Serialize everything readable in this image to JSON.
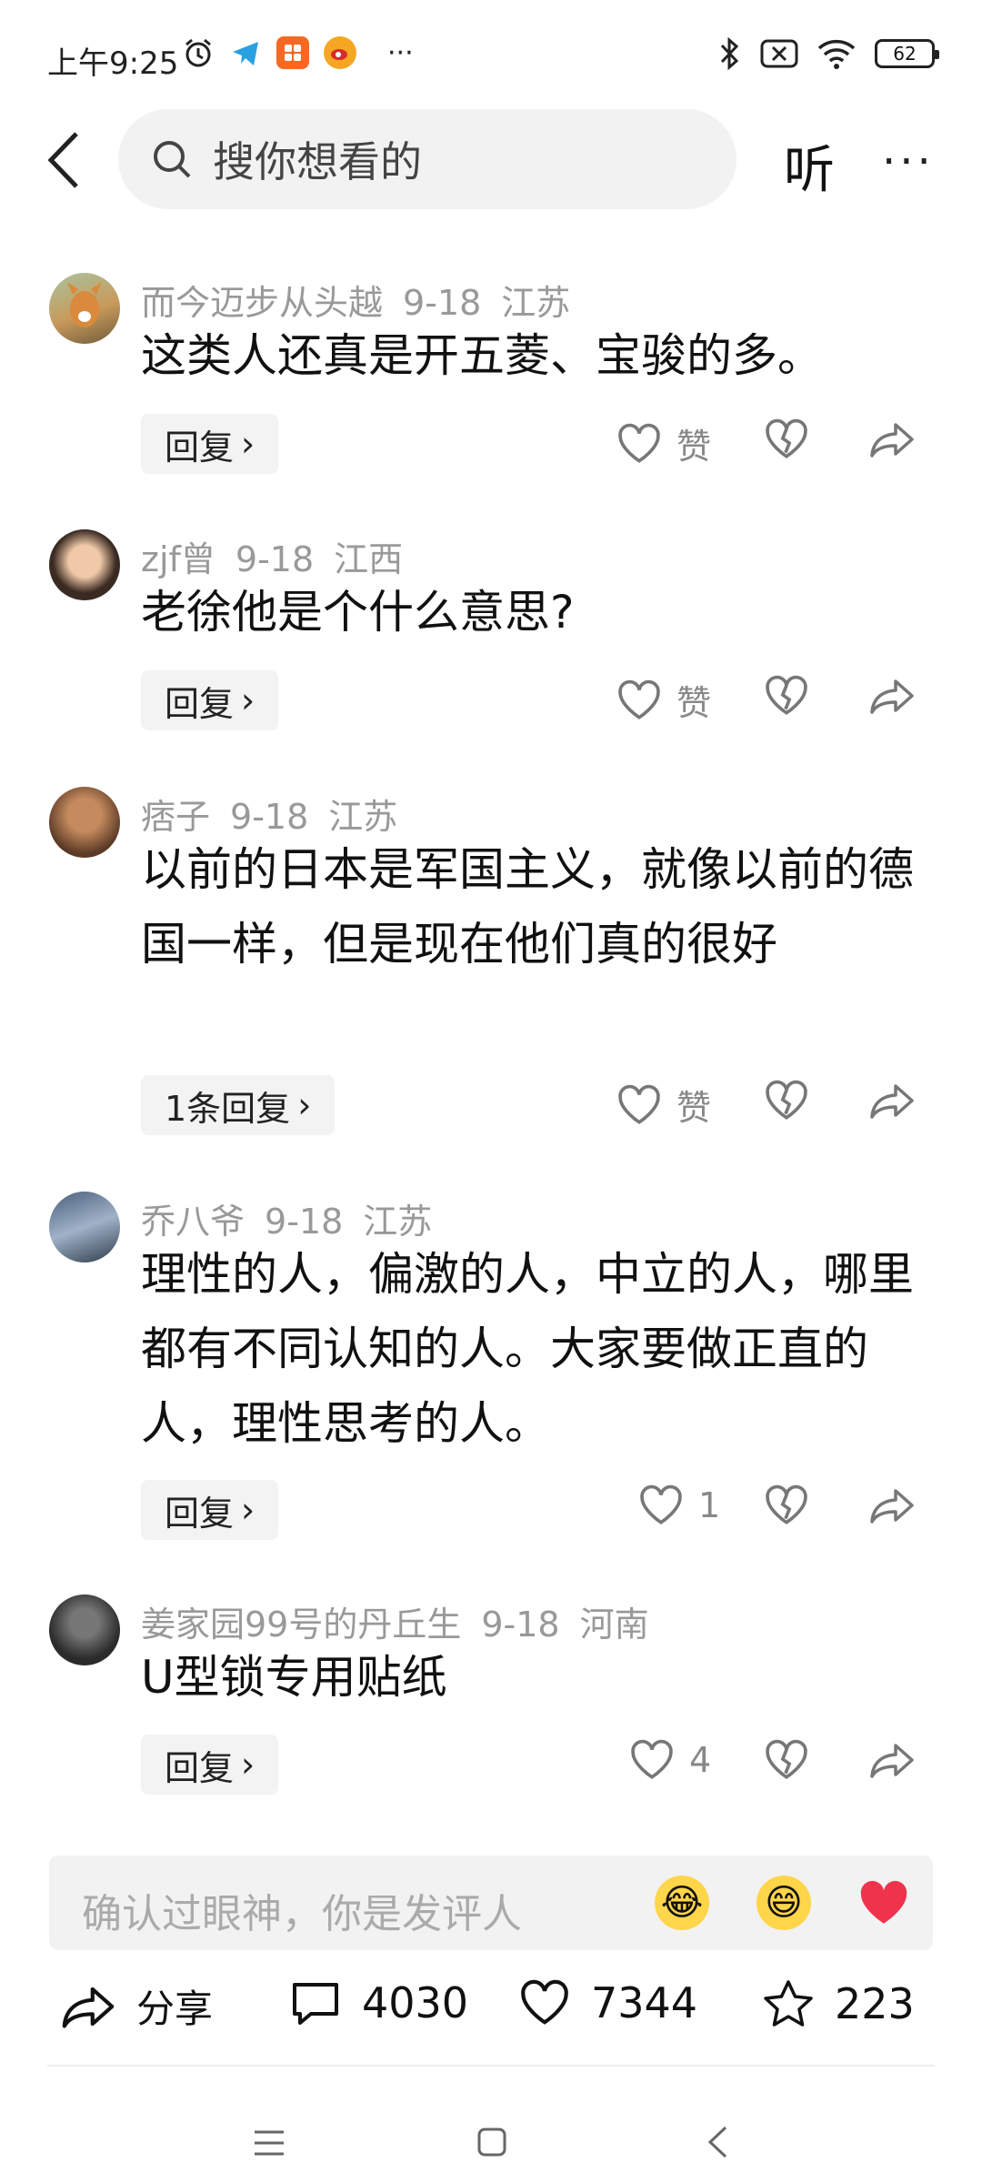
{
  "status": {
    "time": "上午9:25",
    "battery": "62"
  },
  "topbar": {
    "search_placeholder": "搜你想看的",
    "listen": "听",
    "more": "···"
  },
  "comments": [
    {
      "user": "而今迈步从头越",
      "date": "9-18",
      "location": "江苏",
      "text": "这类人还真是开五菱、宝骏的多。",
      "reply": "回复",
      "likes": "赞"
    },
    {
      "user": "zjf曾",
      "date": "9-18",
      "location": "江西",
      "text": "老徐他是个什么意思?",
      "reply": "回复",
      "likes": "赞"
    },
    {
      "user": "痞子",
      "date": "9-18",
      "location": "江苏",
      "text": "以前的日本是军国主义，就像以前的德国一样，但是现在他们真的很好",
      "reply": "1条回复",
      "likes": "赞"
    },
    {
      "user": "乔八爷",
      "date": "9-18",
      "location": "江苏",
      "text": "理性的人，偏激的人，中立的人，哪里都有不同认知的人。大家要做正直的人，理性思考的人。",
      "reply": "回复",
      "likes": "1"
    },
    {
      "user": "姜家园99号的丹丘生",
      "date": "9-18",
      "location": "河南",
      "text": "U型锁专用贴纸",
      "reply": "回复",
      "likes": "4"
    }
  ],
  "composer": {
    "placeholder": "确认过眼神，你是发评人",
    "emojis": [
      "😂",
      "😄",
      "❤️"
    ]
  },
  "actions": {
    "share": "分享",
    "comments": "4030",
    "likes": "7344",
    "favorites": "223"
  }
}
